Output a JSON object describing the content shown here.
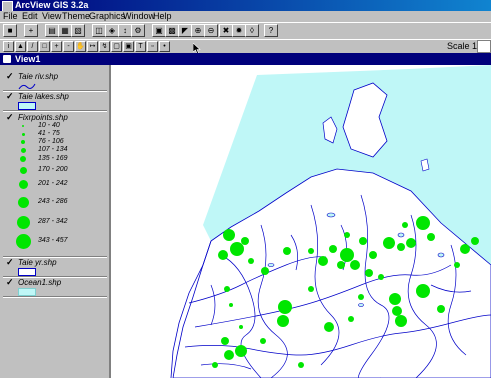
{
  "app": {
    "title": "ArcView GIS 3.2a"
  },
  "menu": [
    "File",
    "Edit",
    "View",
    "Theme",
    "Graphics",
    "Window",
    "Help"
  ],
  "toolbar": {
    "scale_label": "Scale 1"
  },
  "view": {
    "title": "View1"
  },
  "layers": [
    {
      "name": "Taie riv.shp"
    },
    {
      "name": "Taie lakes.shp"
    },
    {
      "name": "Fixrpoints.shp"
    },
    {
      "name": "Taie yr.shp"
    },
    {
      "name": "Ocean1.shp"
    }
  ],
  "fixrpoints_legend": [
    "10 - 40",
    "41 - 75",
    "76 - 106",
    "107 - 134",
    "135 - 169",
    "170 - 200",
    "201 - 242",
    "243 - 286",
    "287 - 342",
    "343 - 457"
  ],
  "colors": {
    "ocean": "#bff7f7",
    "points": "#00e600",
    "rivers": "#0000c8",
    "titlebar": "#00007b"
  }
}
